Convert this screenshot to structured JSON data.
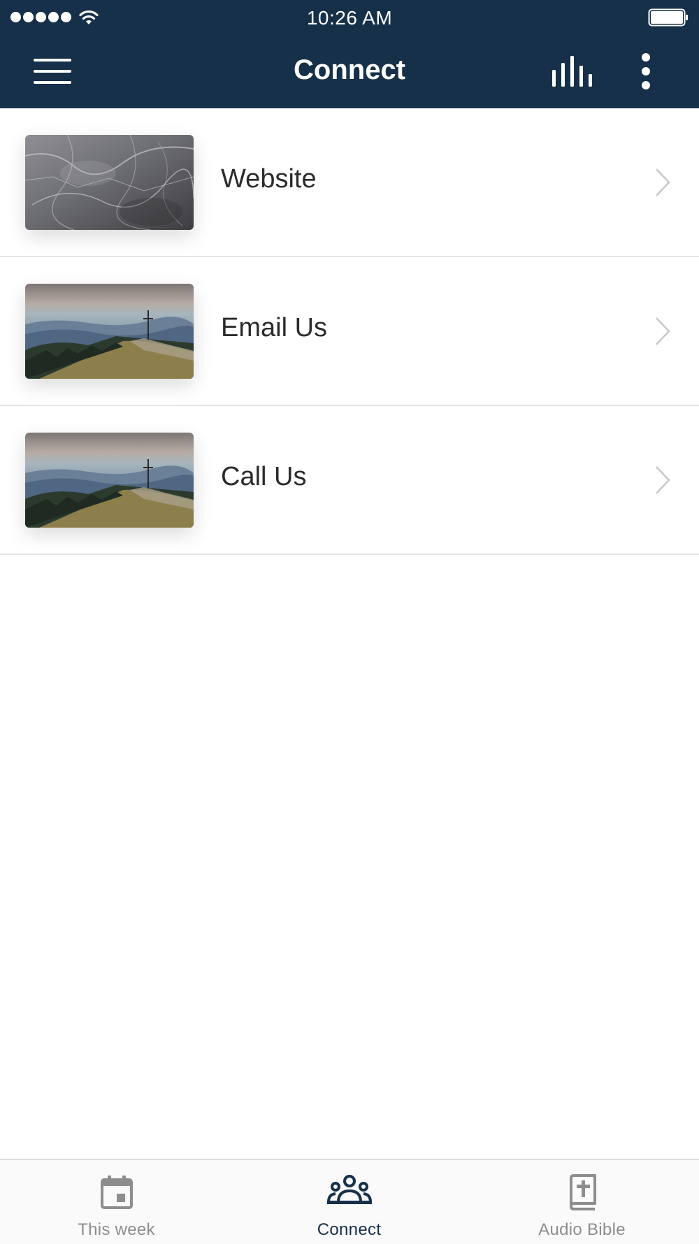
{
  "status_bar": {
    "time": "10:26 AM"
  },
  "header": {
    "title": "Connect"
  },
  "list": {
    "items": [
      {
        "label": "Website",
        "thumbnail": "marble-texture"
      },
      {
        "label": "Email Us",
        "thumbnail": "mountain-cross"
      },
      {
        "label": "Call Us",
        "thumbnail": "mountain-cross"
      }
    ]
  },
  "tabs": [
    {
      "label": "This week",
      "icon": "calendar-icon",
      "active": false
    },
    {
      "label": "Connect",
      "icon": "group-icon",
      "active": true
    },
    {
      "label": "Audio Bible",
      "icon": "bible-icon",
      "active": false
    }
  ],
  "colors": {
    "header_bg": "#163049",
    "active_tab": "#163049",
    "inactive_tab": "#8d8d8d"
  }
}
